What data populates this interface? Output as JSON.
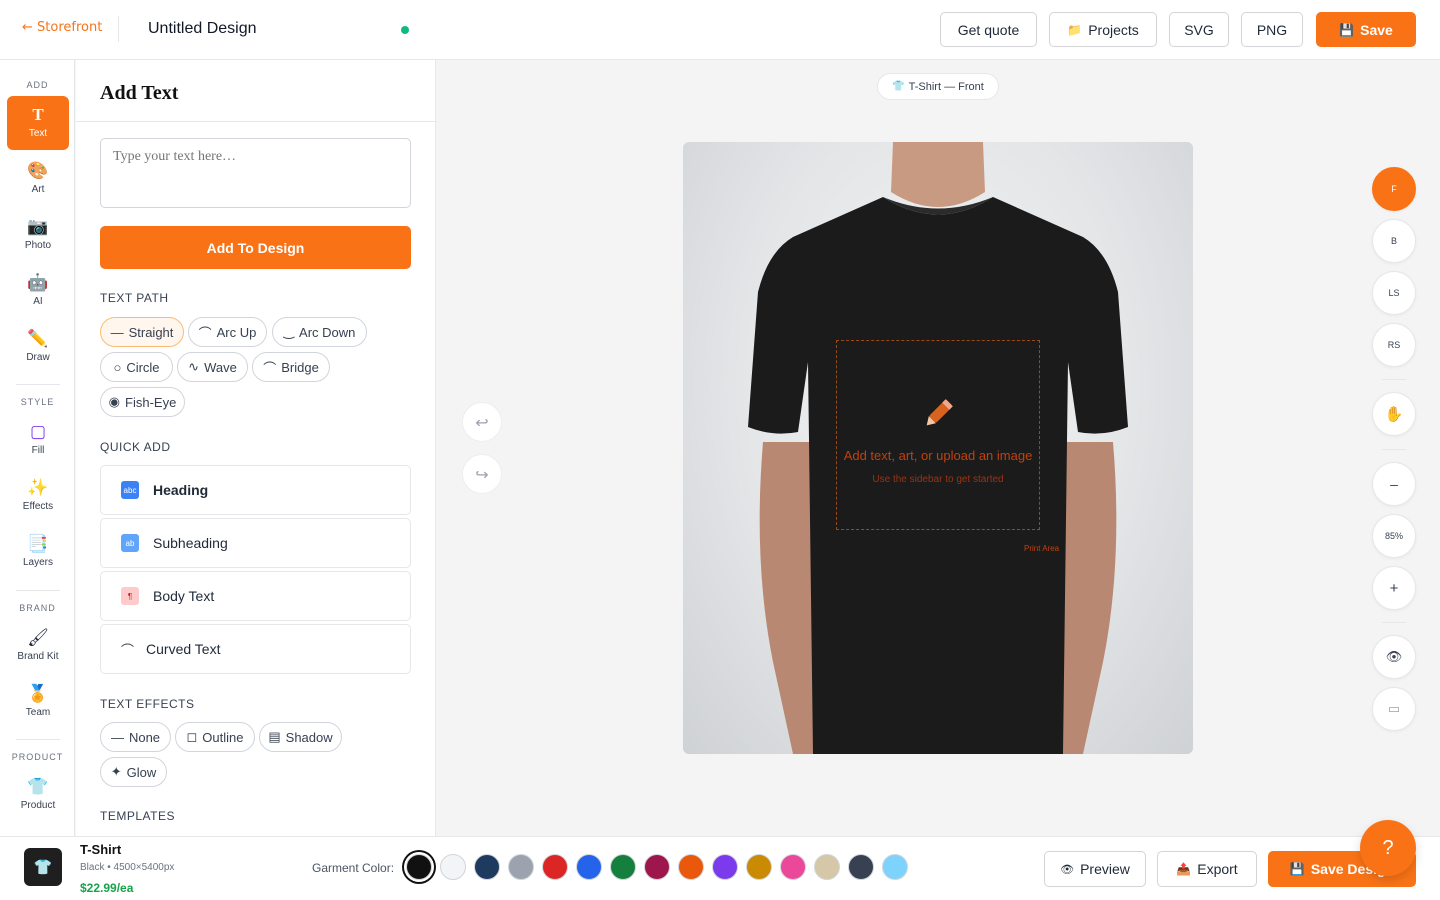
{
  "topbar": {
    "back_label": "← Storefront",
    "title": "Untitled Design",
    "buttons": [
      {
        "label": "Get quote",
        "icon": ""
      },
      {
        "label": "Projects",
        "icon": "folder-icon"
      },
      {
        "label": "SVG",
        "icon": ""
      },
      {
        "label": "PNG",
        "icon": ""
      },
      {
        "label": "Save",
        "icon": "floppy-icon"
      }
    ],
    "status_color": "#10b981"
  },
  "rail": {
    "sections": [
      "ADD",
      "STYLE",
      "BRAND",
      "PRODUCT"
    ],
    "items": [
      {
        "label": "Text",
        "glyph": "T",
        "active": true
      },
      {
        "label": "Art",
        "glyph": "🎨"
      },
      {
        "label": "Photo",
        "glyph": "📷"
      },
      {
        "label": "AI",
        "glyph": "🤖"
      },
      {
        "label": "Draw",
        "glyph": "✏️"
      },
      {
        "label": "Fill",
        "glyph": "▢"
      },
      {
        "label": "Effects",
        "glyph": "✨"
      },
      {
        "label": "Layers",
        "glyph": "📑"
      },
      {
        "label": "Brand Kit",
        "glyph": "🖌"
      },
      {
        "label": "Team",
        "glyph": "🏅"
      },
      {
        "label": "Product",
        "glyph": "👕"
      }
    ]
  },
  "panel": {
    "heading": "Add Text",
    "textarea_placeholder": "Type your text here…",
    "add_button": "Add To Design",
    "text_path_heading": "TEXT PATH",
    "text_paths": [
      {
        "label": "Straight",
        "glyph": "—",
        "active": true
      },
      {
        "label": "Arc Up",
        "glyph": "⌒"
      },
      {
        "label": "Arc Down",
        "glyph": "‿"
      },
      {
        "label": "Circle",
        "glyph": "○"
      },
      {
        "label": "Wave",
        "glyph": "∿"
      },
      {
        "label": "Bridge",
        "glyph": "⌒"
      },
      {
        "label": "Fish-Eye",
        "glyph": "◉"
      }
    ],
    "quick_add_heading": "QUICK ADD",
    "quick_add": [
      {
        "label": "Heading",
        "icon_text": "abc",
        "color": "#3b82f6",
        "weight": "bold"
      },
      {
        "label": "Subheading",
        "icon_text": "ab",
        "color": "#60a5fa",
        "weight": "normal"
      },
      {
        "label": "Body Text",
        "icon_text": "¶",
        "color": "#f87171",
        "weight": "normal"
      },
      {
        "label": "Curved Text",
        "icon_text": "⌒",
        "color": "transparent",
        "weight": "normal"
      }
    ],
    "effects_heading": "TEXT EFFECTS",
    "effects": [
      {
        "label": "None",
        "glyph": "—"
      },
      {
        "label": "Outline",
        "glyph": "◻"
      },
      {
        "label": "Shadow",
        "glyph": "▤"
      },
      {
        "label": "Glow",
        "glyph": "✦"
      }
    ],
    "templates_heading": "TEMPLATES"
  },
  "canvas": {
    "view_label": "T-Shirt — Front",
    "placeholder_title": "Add text, art, or upload an image",
    "placeholder_sub": "Use the sidebar to get started",
    "print_area_label": "Print Area",
    "undo_glyph": "↩",
    "redo_glyph": "↪"
  },
  "right_tools": {
    "views": [
      {
        "label": "F",
        "active": true
      },
      {
        "label": "B"
      },
      {
        "label": "LS"
      },
      {
        "label": "RS"
      }
    ],
    "pan_glyph": "✋",
    "zoom_out": "–",
    "zoom_level": "85%",
    "zoom_in": "+",
    "preview_glyph": "👁",
    "fit_glyph": "▭"
  },
  "bottom": {
    "product_name": "T-Shirt",
    "product_meta": "Black • 4500×5400px",
    "price": "$22.99/ea",
    "garment_color_label": "Garment Color:",
    "colors": [
      "#111111",
      "#f3f4f6",
      "#1e3a5f",
      "#9ca3af",
      "#dc2626",
      "#2563eb",
      "#15803d",
      "#9d174d",
      "#ea580c",
      "#7c3aed",
      "#ca8a04",
      "#ec4899",
      "#d6c7a8",
      "#374151",
      "#7dd3fc"
    ],
    "selected_color": "#111111",
    "buttons": [
      {
        "label": "Preview",
        "icon": "eye-icon"
      },
      {
        "label": "Export",
        "icon": "export-icon"
      },
      {
        "label": "Save Design",
        "icon": "floppy-icon"
      }
    ]
  },
  "help_label": "?"
}
